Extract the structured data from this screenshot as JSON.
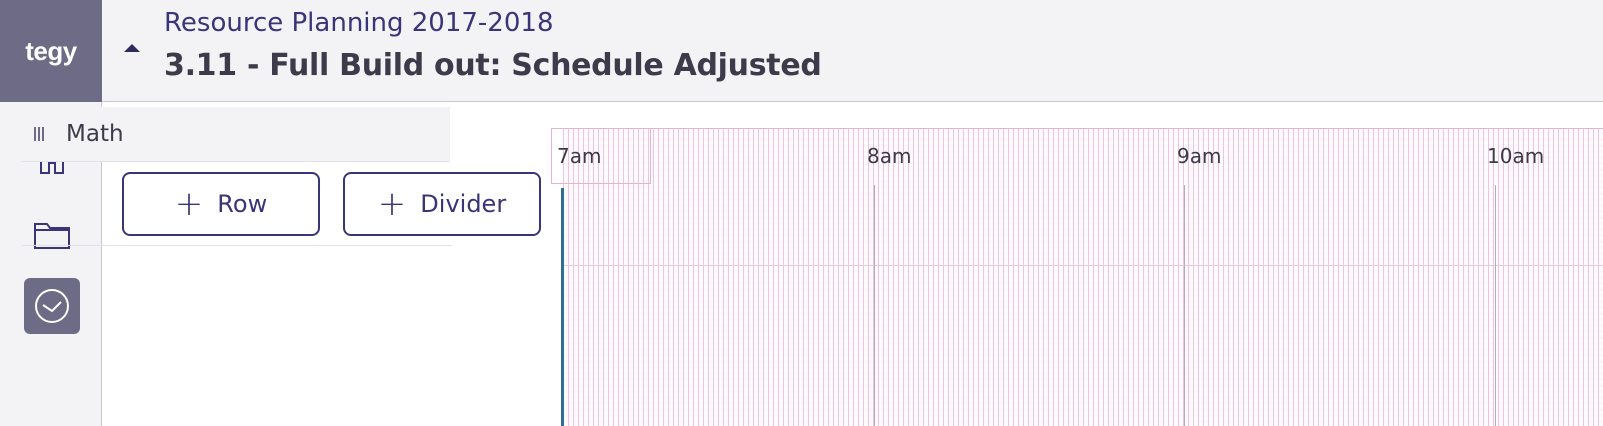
{
  "brand": {
    "logo_text": "tegy"
  },
  "header": {
    "project": "Resource Planning 2017-2018",
    "scenario": "3.11 - Full Build out: Schedule Adjusted",
    "collapse_icon": "caret-up-icon"
  },
  "sidebar": {
    "items": [
      {
        "name": "home",
        "icon": "home-icon",
        "active": false
      },
      {
        "name": "folder",
        "icon": "folder-icon",
        "active": false
      },
      {
        "name": "schedule",
        "icon": "clock-icon",
        "active": true
      }
    ]
  },
  "rows": [
    {
      "label": "Math"
    }
  ],
  "actions": {
    "add_row": "Row",
    "add_divider": "Divider"
  },
  "timeline": {
    "hours": [
      "7am",
      "8am",
      "9am",
      "10am"
    ]
  },
  "colors": {
    "accent": "#3a3478",
    "logo_bg": "#6d6b85",
    "grid_pink": "#e9c7dc",
    "timeline_marker": "#2e6e98"
  }
}
